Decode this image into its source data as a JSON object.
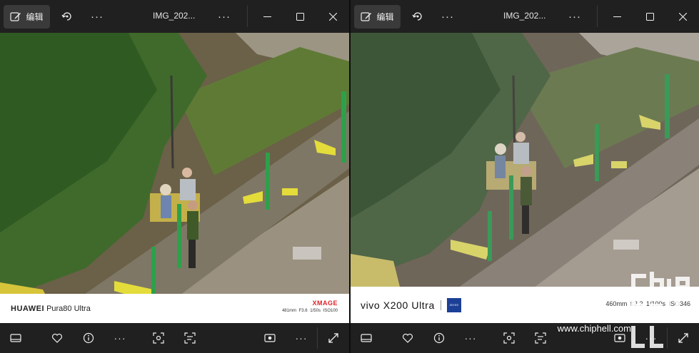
{
  "left": {
    "toolbar": {
      "edit_label": "编辑",
      "more": "···",
      "title": "IMG_202...",
      "more2": "···"
    },
    "watermark": {
      "brand": "HUAWEI",
      "model": "Pura80 Ultra",
      "logo": "XMAGE",
      "params": "481mm  F3.6  1/50s  ISO100"
    },
    "bottom": {
      "more": "···",
      "more2": "···"
    }
  },
  "right": {
    "toolbar": {
      "edit_label": "编辑",
      "more": "···",
      "title": "IMG_202...",
      "more2": "···"
    },
    "watermark": {
      "brand": "vivo X200 Ultra",
      "zeiss": "ZEISS",
      "params": "460mm  f/2.2  1/100s  ISO346"
    },
    "bottom": {
      "more": "···",
      "more2": "···"
    },
    "site_watermark": "www.chiphell.com",
    "logo_text": "chiphell"
  },
  "colors": {
    "bg": "#202020",
    "accent_red": "#e0242a",
    "zeiss_blue": "#1c3f96"
  }
}
